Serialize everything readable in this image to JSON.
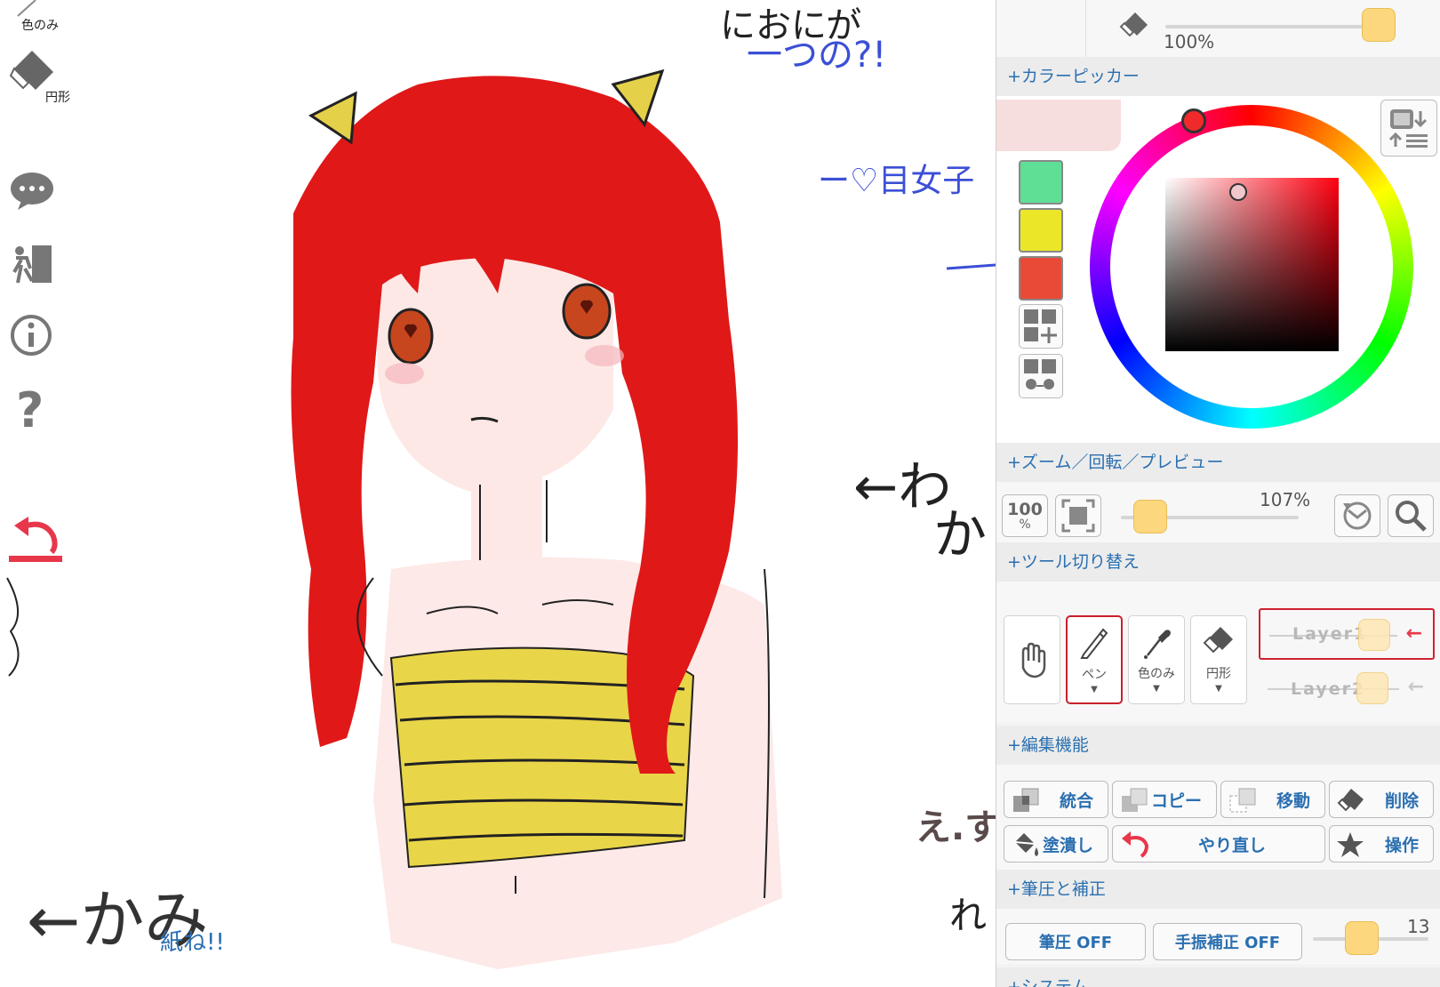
{
  "left_toolbar": {
    "iro_nomi_label": "色のみ",
    "enkei_label": "円形"
  },
  "brush_panel": {
    "opacity": "100%"
  },
  "color_picker": {
    "header": "+カラーピッカー",
    "swatches": [
      "#5fde96",
      "#ece629",
      "#e84a37"
    ]
  },
  "zoom": {
    "header": "+ズーム／回転／プレビュー",
    "reset_top": "100",
    "reset_bottom": "%",
    "value": "107%"
  },
  "tools": {
    "header": "+ツール切り替え",
    "pen": "ペン",
    "dropper": "色のみ",
    "eraser": "円形",
    "layers": [
      {
        "name": "Layer1"
      },
      {
        "name": "Layer2"
      }
    ]
  },
  "edit": {
    "header": "+編集機能",
    "merge": "統合",
    "copy": "コピー",
    "move": "移動",
    "delete": "削除",
    "fill": "塗潰し",
    "redo": "やり直し",
    "operation": "操作"
  },
  "pressure": {
    "header": "+筆圧と補正",
    "pressure_btn": "筆圧 OFF",
    "stabilizer_btn": "手振補正 OFF",
    "value": "13"
  },
  "system": {
    "header": "+システム"
  },
  "canvas_text": {
    "top_line1": "におにが",
    "top_line2": "一つの?!",
    "heart_note": "ー♡目女子",
    "right_arrow": "←わ",
    "right_arrow2": "か",
    "right_note": "え.す",
    "right_note2": "れ",
    "kami": "←かみ",
    "kami_sub": "紙ね!!"
  },
  "colors": {
    "accent_text": "#2a6fb0",
    "knob": "#fdd77d",
    "active_border": "#c9202a",
    "undo": "#e8374a"
  }
}
